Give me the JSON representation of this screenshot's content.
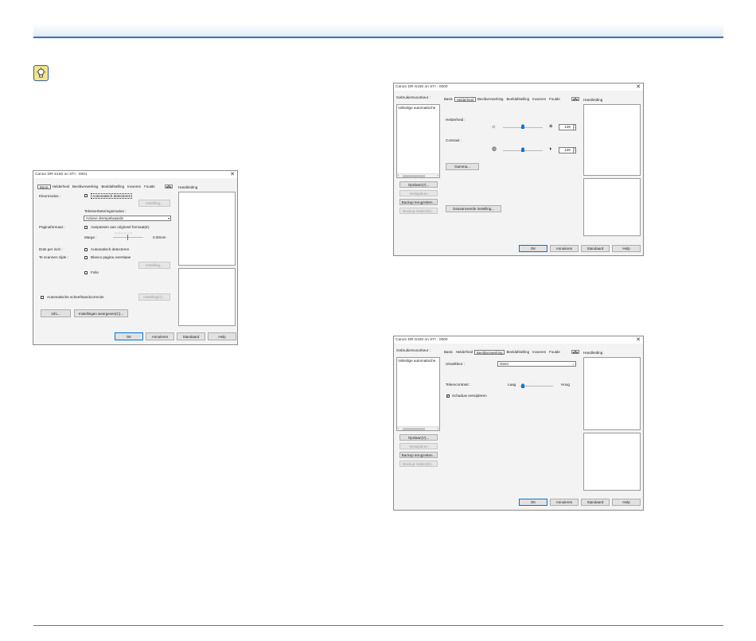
{
  "dialog_title": "Canon DR-S150 on STI - 0001",
  "dialog_title_0000": "Canon DR-S150 on STI - 0000",
  "close_glyph": "✕",
  "left_dialog": {
    "tabs": [
      "Basis",
      "Helderheid",
      "Beeldverwerking",
      "Beeldafstelling",
      "Invoeren",
      "Foutde"
    ],
    "manual_label": "Handleiding",
    "kleurmodus_label": "Kleurmodus :",
    "auto_detect": "Automatisch detecteren",
    "instelling_btn": "Instelling...",
    "tekstverbetering_label": "Tekstverbeteringsmodus :",
    "tekstverbetering_value": "Actieve drempelwaarde",
    "paginaformaat_label": "Paginaformaat :",
    "aanpassen_label": "Aanpassen aan origineel formaat(E)",
    "marge_label": "Marge :",
    "marge_value": "0.00mm",
    "dpi_label": "Dots per inch :",
    "dpi_auto": "Automatisch detecteren",
    "te_scannen_label": "Te scannen zijde :",
    "blanco_label": "Blanco pagina overslaan",
    "instelling_btn2": "Instelling...",
    "folio_label": "Folio",
    "auto_scheef_label": "Automatische scheefstandcorrectie",
    "instelling_btn3": "Instelling(V)...",
    "info_btn": "Info...",
    "weergeven_btn": "Instellingen weergeven(C)...",
    "ok_btn": "OK",
    "annuleren_btn": "Annuleren",
    "standaard_btn": "Standaard",
    "help_btn": "Help"
  },
  "right_top": {
    "gebruiker_label": "Gebruikersvoorkeur :",
    "preset_item": "Volledige automatische",
    "tabs": [
      "Basis",
      "Helderheid",
      "Beeldverwerking",
      "Beeldafstelling",
      "Invoeren",
      "Foutde"
    ],
    "manual_label": "Handleiding",
    "helderheid_label": "Helderheid :",
    "helderheid_value": "128",
    "contrast_label": "Contrast :",
    "contrast_value": "128",
    "gamma_btn": "Gamma...",
    "geavanceerde_btn": "Geavanceerde instelling...",
    "opslaan_btn": "Opslaan(V)...",
    "verwijderen_btn": "Verwijderen",
    "backup_terug_btn": "Backup terugzetten...",
    "backup_maken_btn": "Backup maken(E)...",
    "ok_btn": "OK",
    "annuleren_btn": "Annuleren",
    "standaard_btn": "Standaard",
    "help_btn": "Help"
  },
  "right_bottom": {
    "gebruiker_label": "Gebruikersvoorkeur :",
    "preset_item": "Volledige automatische",
    "tabs": [
      "Basis",
      "Helderheid",
      "Beeldverwerking",
      "Beeldafstelling",
      "Invoeren",
      "Foutde"
    ],
    "manual_label": "Handleiding",
    "uitvalkleur_label": "Uitvalkleur :",
    "uitvalkleur_value": "Geen",
    "tekencontrast_label": "Tekencontrast :",
    "laag_label": "Laag",
    "hoog_label": "Hoog",
    "schaduw_label": "Schaduw verwijderen",
    "opslaan_btn": "Opslaan(V)...",
    "verwijderen_btn": "Verwijderen",
    "backup_terug_btn": "Backup terugzetten...",
    "backup_maken_btn": "Backup maken(E)...",
    "ok_btn": "OK",
    "annuleren_btn": "Annuleren",
    "standaard_btn": "Standaard",
    "help_btn": "Help"
  }
}
